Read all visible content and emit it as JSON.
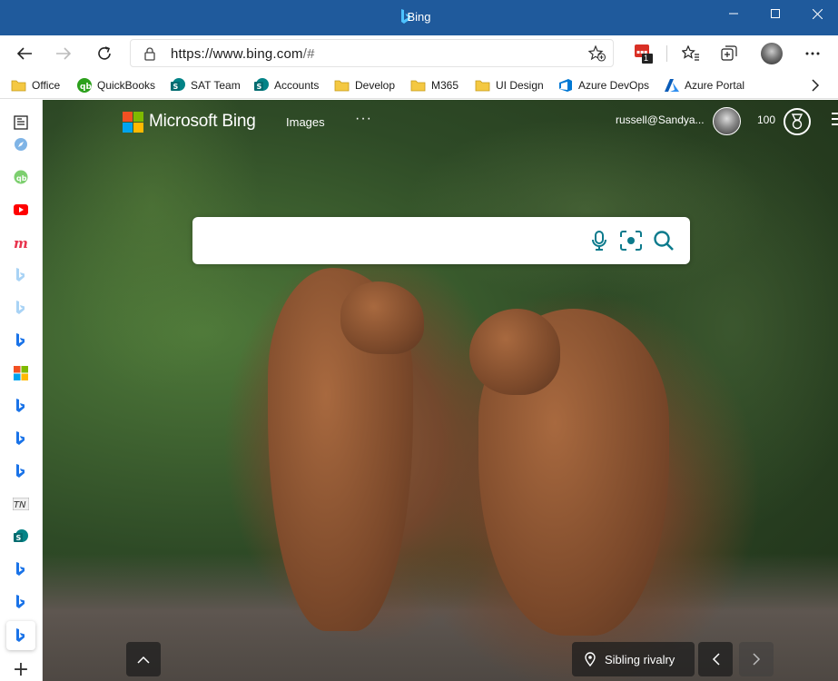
{
  "window": {
    "title": "Bing"
  },
  "address_bar": {
    "url_scheme": "https://",
    "url_host": "www.bing.com",
    "url_path": "/#"
  },
  "extension_badge": "1",
  "bookmarks": [
    {
      "label": "Office",
      "icon": "folder-icon"
    },
    {
      "label": "QuickBooks",
      "icon": "quickbooks-icon"
    },
    {
      "label": "SAT Team",
      "icon": "sharepoint-icon"
    },
    {
      "label": "Accounts",
      "icon": "sharepoint-icon"
    },
    {
      "label": "Develop",
      "icon": "folder-icon"
    },
    {
      "label": "M365",
      "icon": "folder-icon"
    },
    {
      "label": "UI Design",
      "icon": "folder-icon"
    },
    {
      "label": "Azure DevOps",
      "icon": "azure-devops-icon"
    },
    {
      "label": "Azure Portal",
      "icon": "azure-icon"
    }
  ],
  "sidebar": {
    "items": [
      "news-icon",
      "safari-icon",
      "quickbooks-icon",
      "youtube-icon",
      "m-icon",
      "bing-icon",
      "bing-icon",
      "bing-icon",
      "microsoft-icon",
      "bing-icon",
      "bing-icon",
      "bing-icon",
      "tn-icon",
      "sharepoint-icon",
      "bing-icon",
      "bing-icon",
      "bing-icon"
    ],
    "add_label": "+"
  },
  "bing": {
    "brand": "Microsoft Bing",
    "nav_images": "Images",
    "more": "···",
    "user": "russell@Sandya...",
    "points": "100",
    "search_placeholder": "",
    "location_label": "Sibling rivalry"
  },
  "colors": {
    "titlebar": "#1f5a9c",
    "ms_red": "#f25022",
    "ms_green": "#7fba00",
    "ms_blue": "#00a4ef",
    "ms_yellow": "#ffb900",
    "bing_teal": "#0c7a8c"
  }
}
